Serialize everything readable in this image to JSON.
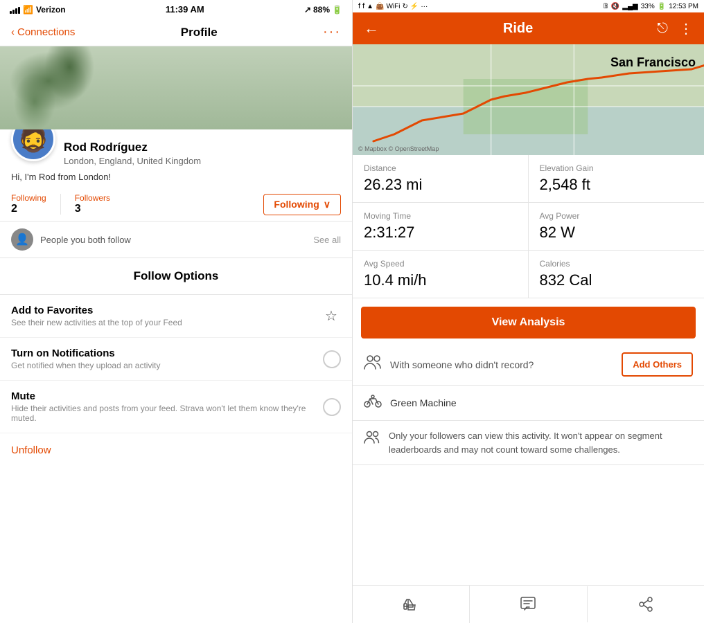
{
  "left": {
    "statusBar": {
      "carrier": "Verizon",
      "time": "11:39 AM",
      "battery": "88%"
    },
    "navBar": {
      "back": "Connections",
      "title": "Profile",
      "more": "···"
    },
    "profile": {
      "name": "Rod Rodríguez",
      "location": "London, England, United Kingdom",
      "bio": "Hi, I'm Rod from London!",
      "avatar": "🧔",
      "followingLabel": "Following",
      "followersLabel": "Followers",
      "followingCount": "2",
      "followersCount": "3",
      "followingBtn": "Following",
      "mutualText": "People you both follow",
      "seeAll": "See all"
    },
    "followOptions": {
      "title": "Follow Options",
      "items": [
        {
          "title": "Add to Favorites",
          "desc": "See their new activities at the top of your Feed",
          "iconType": "star"
        },
        {
          "title": "Turn on Notifications",
          "desc": "Get notified when they upload an activity",
          "iconType": "circle"
        },
        {
          "title": "Mute",
          "desc": "Hide their activities and posts from your feed. Strava won't let them know they're muted.",
          "iconType": "circle"
        }
      ],
      "unfollowLabel": "Unfollow"
    }
  },
  "right": {
    "statusBar": {
      "icons": "Facebook Facebook Triangle Bag Wifi Refresh Bolt ··· Bluetooth Mute Wifi Bars 33% Battery 12:53 PM",
      "battery": "33%",
      "time": "12:53 PM"
    },
    "navBar": {
      "title": "Ride",
      "back": "←",
      "share": "⎋",
      "more": "⋮"
    },
    "map": {
      "label": "San Francisco",
      "attribution": "© Mapbox © OpenStreetMap"
    },
    "stats": [
      {
        "label": "Distance",
        "value": "26.23 mi"
      },
      {
        "label": "Elevation Gain",
        "value": "2,548 ft"
      },
      {
        "label": "Moving Time",
        "value": "2:31:27"
      },
      {
        "label": "Avg Power",
        "value": "82 W"
      },
      {
        "label": "Avg Speed",
        "value": "10.4 mi/h"
      },
      {
        "label": "Calories",
        "value": "832 Cal"
      }
    ],
    "viewAnalysisBtn": "View Analysis",
    "rideWith": {
      "question": "With someone who didn't record?",
      "addOthersBtn": "Add Others"
    },
    "bike": {
      "name": "Green Machine"
    },
    "privacy": {
      "text": "Only your followers can view this activity. It won't appear on segment leaderboards and may not count toward some challenges."
    },
    "actions": [
      "👍",
      "💬",
      "⎋"
    ]
  }
}
